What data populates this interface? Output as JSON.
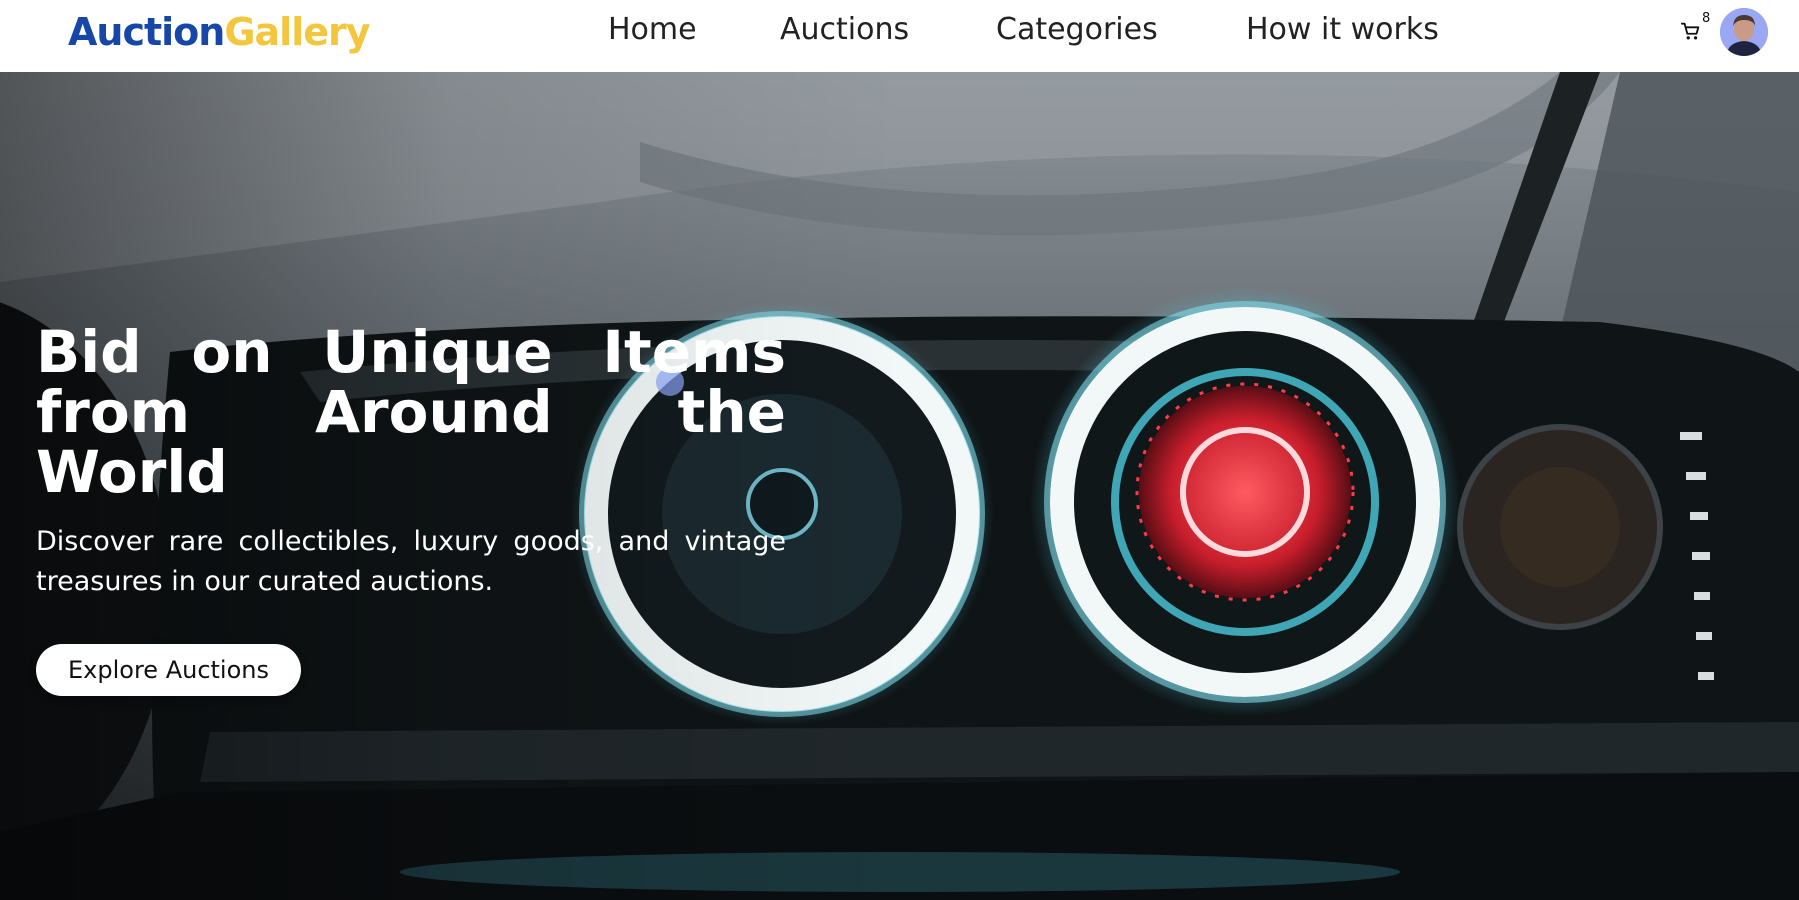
{
  "brand": {
    "part1": "Auction",
    "part2": "Gallery",
    "color_part1": "#1546a8",
    "color_part2": "#f4c63d"
  },
  "nav": {
    "links": [
      {
        "label": "Home"
      },
      {
        "label": "Auctions"
      },
      {
        "label": "Categories"
      },
      {
        "label": "How it works"
      }
    ]
  },
  "cart": {
    "icon": "cart-icon",
    "count": "8"
  },
  "user": {
    "icon": "user-avatar"
  },
  "hero": {
    "title": "Bid on Unique Items from Around the World",
    "subtitle": "Discover rare collectibles, luxury goods, and vintage treasures in our curated auctions.",
    "cta_label": "Explore Auctions",
    "background": "car-headlight-photo"
  }
}
